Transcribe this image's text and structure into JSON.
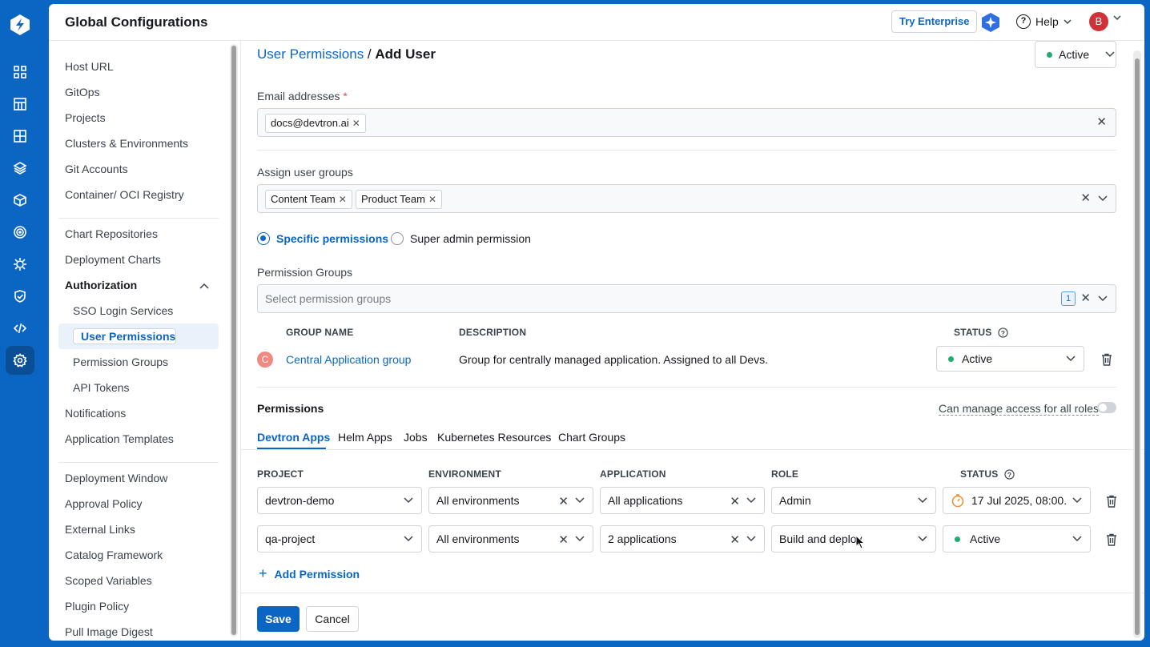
{
  "app": {
    "title": "Global Configurations"
  },
  "header": {
    "try_label": "Try Enterprise",
    "help_label": "Help",
    "avatar_initial": "B"
  },
  "rail_icons": [
    "apps-icon",
    "chart-icon",
    "grid-icon",
    "stack-icon",
    "cube-icon",
    "target-icon",
    "bug-icon",
    "shield-icon",
    "code-icon",
    "settings-icon"
  ],
  "sidebar": {
    "group1": [
      "Host URL",
      "GitOps",
      "Projects",
      "Clusters & Environments",
      "Git Accounts",
      "Container/ OCI Registry"
    ],
    "group2": [
      "Chart Repositories",
      "Deployment Charts"
    ],
    "authorization": "Authorization",
    "auth_items": [
      "SSO Login Services",
      "User Permissions",
      "Permission Groups",
      "API Tokens"
    ],
    "group3": [
      "Notifications",
      "Application Templates"
    ],
    "group4": [
      "Deployment Window",
      "Approval Policy",
      "External Links",
      "Catalog Framework",
      "Scoped Variables",
      "Plugin Policy",
      "Pull Image Digest"
    ]
  },
  "breadcrumb": {
    "parent": "User Permissions",
    "separator": " / ",
    "current": "Add User"
  },
  "user_status": "Active",
  "email": {
    "label": "Email addresses",
    "required_mark": "*",
    "chips": [
      "docs@devtron.ai"
    ]
  },
  "user_groups": {
    "label": "Assign user groups",
    "chips": [
      "Content Team",
      "Product Team"
    ]
  },
  "permission_type": {
    "specific": "Specific permissions",
    "super_admin": "Super admin permission",
    "selected": "specific"
  },
  "permission_groups": {
    "label": "Permission Groups",
    "placeholder": "Select permission groups",
    "count": "1",
    "columns": {
      "name": "GROUP NAME",
      "description": "DESCRIPTION",
      "status": "STATUS"
    },
    "rows": [
      {
        "initial": "C",
        "name": "Central Application group",
        "description": "Group for centrally managed application. Assigned to all Devs.",
        "status": "Active"
      }
    ]
  },
  "permissions": {
    "title": "Permissions",
    "manage_all": "Can manage access for all roles",
    "tabs": [
      "Devtron Apps",
      "Helm Apps",
      "Jobs",
      "Kubernetes Resources",
      "Chart Groups"
    ],
    "active_tab": "Devtron Apps",
    "columns": {
      "project": "PROJECT",
      "environment": "ENVIRONMENT",
      "application": "APPLICATION",
      "role": "ROLE",
      "status": "STATUS"
    },
    "rows": [
      {
        "project": "devtron-demo",
        "environment": "All environments",
        "application": "All applications",
        "role": "Admin",
        "status": "17 Jul 2025, 08:00..."
      },
      {
        "project": "qa-project",
        "environment": "All environments",
        "application": "2 applications",
        "role": "Build and deploy",
        "status": "Active"
      }
    ],
    "add_label": "Add Permission"
  },
  "actions": {
    "save": "Save",
    "cancel": "Cancel"
  },
  "colors": {
    "brand": "#0b66c3",
    "active_dot": "#1dad70",
    "avatar": "#d0323a",
    "timer": "#f08c2e"
  }
}
